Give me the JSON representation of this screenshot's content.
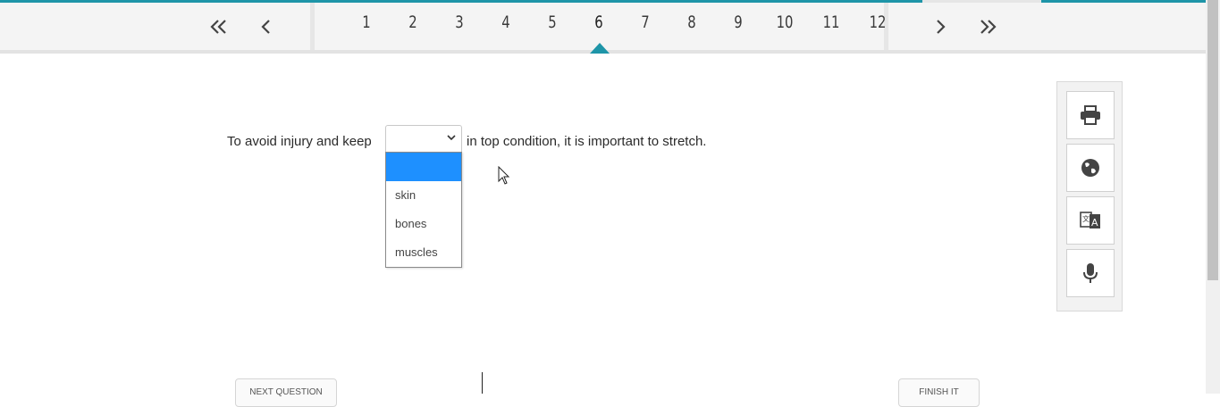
{
  "navigation": {
    "first_label": "«",
    "prev_label": "‹",
    "next_label": "›",
    "last_label": "»",
    "pages": [
      "1",
      "2",
      "3",
      "4",
      "5",
      "6",
      "7",
      "8",
      "9",
      "10",
      "11",
      "12"
    ],
    "current_page": "6"
  },
  "question": {
    "text_before": "To avoid injury and keep",
    "text_after": "in top condition, it is important to stretch.",
    "select": {
      "selected_value": "",
      "options": [
        "",
        "skin",
        "bones",
        "muscles"
      ]
    }
  },
  "tools": [
    {
      "name": "print-icon"
    },
    {
      "name": "globe-icon"
    },
    {
      "name": "translate-icon"
    },
    {
      "name": "microphone-icon"
    }
  ],
  "footer": {
    "left_button_label": "NEXT QUESTION",
    "right_button_label": "FINISH IT"
  },
  "colors": {
    "accent": "#1e95a8",
    "dropdown_highlight": "#1e90ff"
  }
}
